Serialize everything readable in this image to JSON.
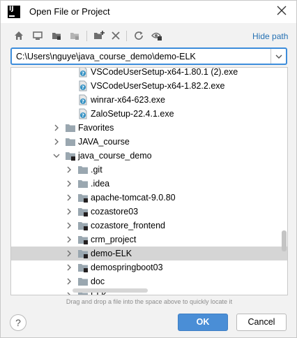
{
  "window": {
    "title": "Open File or Project",
    "app_icon_text": "IJ"
  },
  "toolbar": {
    "buttons": [
      "home-icon",
      "desktop-icon",
      "project-folder-icon",
      "module-folder-icon",
      "new-folder-icon",
      "delete-icon",
      "refresh-icon",
      "show-hidden-icon"
    ],
    "hide_path_label": "Hide path"
  },
  "path": {
    "value": "C:\\Users\\nguye\\java_course_demo\\demo-ELK"
  },
  "tree": {
    "rows": [
      {
        "label": "VSCodeUserSetup-x64-1.80.1 (2).exe",
        "kind": "unknown-file",
        "depth": 2,
        "expandable": false
      },
      {
        "label": "VSCodeUserSetup-x64-1.82.2.exe",
        "kind": "unknown-file",
        "depth": 2,
        "expandable": false
      },
      {
        "label": "winrar-x64-623.exe",
        "kind": "unknown-file",
        "depth": 2,
        "expandable": false
      },
      {
        "label": "ZaloSetup-22.4.1.exe",
        "kind": "unknown-file",
        "depth": 2,
        "expandable": false
      },
      {
        "label": "Favorites",
        "kind": "folder",
        "depth": 1,
        "expandable": true,
        "expanded": false
      },
      {
        "label": "JAVA_course",
        "kind": "folder",
        "depth": 1,
        "expandable": true,
        "expanded": false
      },
      {
        "label": "java_course_demo",
        "kind": "project-folder",
        "depth": 1,
        "expandable": true,
        "expanded": true
      },
      {
        "label": ".git",
        "kind": "folder",
        "depth": 2,
        "expandable": true,
        "expanded": false
      },
      {
        "label": ".idea",
        "kind": "folder",
        "depth": 2,
        "expandable": true,
        "expanded": false
      },
      {
        "label": "apache-tomcat-9.0.80",
        "kind": "project-folder",
        "depth": 2,
        "expandable": true,
        "expanded": false
      },
      {
        "label": "cozastore03",
        "kind": "project-folder",
        "depth": 2,
        "expandable": true,
        "expanded": false
      },
      {
        "label": "cozastore_frontend",
        "kind": "project-folder",
        "depth": 2,
        "expandable": true,
        "expanded": false
      },
      {
        "label": "crm_project",
        "kind": "project-folder",
        "depth": 2,
        "expandable": true,
        "expanded": false
      },
      {
        "label": "demo-ELK",
        "kind": "project-folder",
        "depth": 2,
        "expandable": true,
        "expanded": false,
        "selected": true
      },
      {
        "label": "demospringboot03",
        "kind": "project-folder",
        "depth": 2,
        "expandable": true,
        "expanded": false
      },
      {
        "label": "doc",
        "kind": "folder",
        "depth": 2,
        "expandable": true,
        "expanded": false
      },
      {
        "label": "ELK",
        "kind": "folder",
        "depth": 2,
        "expandable": true,
        "expanded": false
      }
    ]
  },
  "hint": "Drag and drop a file into the space above to quickly locate it",
  "buttons": {
    "help": "?",
    "ok": "OK",
    "cancel": "Cancel"
  },
  "colors": {
    "accent": "#4a8ed6",
    "link": "#2470b3",
    "selection": "#d5d5d5",
    "focus_border": "#3d8ddb"
  }
}
